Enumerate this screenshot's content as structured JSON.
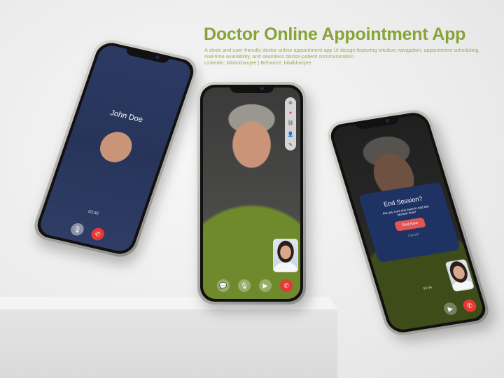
{
  "header": {
    "title": "Doctor Online Appointment App",
    "description": "A sleek and user-friendly doctor online appointment app UI design featuring intuitive navigation, appointment scheduling, real-time availability, and seamless doctor-patient communication.",
    "credits": "Linkedin: bilalxkhanjee | Behance: bilalkhanjee"
  },
  "left_phone": {
    "caller_name": "John Doe",
    "timer": "03:46",
    "icons": [
      "mic-icon",
      "end-call-icon"
    ]
  },
  "center_phone": {
    "side_tools": [
      "close-icon",
      "record-icon",
      "link-icon",
      "add-user-icon",
      "pen-icon"
    ],
    "controls": [
      "chat-icon",
      "mic-icon",
      "video-icon",
      "end-call-icon"
    ]
  },
  "right_phone": {
    "dialog": {
      "title": "End Session?",
      "message": "Are you sure you want to end this session now?",
      "confirm_label": "End Now",
      "cancel_label": "Cancel"
    },
    "timer": "03:46"
  },
  "colors": {
    "accent": "#8aa338",
    "danger": "#e53935",
    "dialog_bg": "#1e3264",
    "call_bg": "#27345a"
  }
}
